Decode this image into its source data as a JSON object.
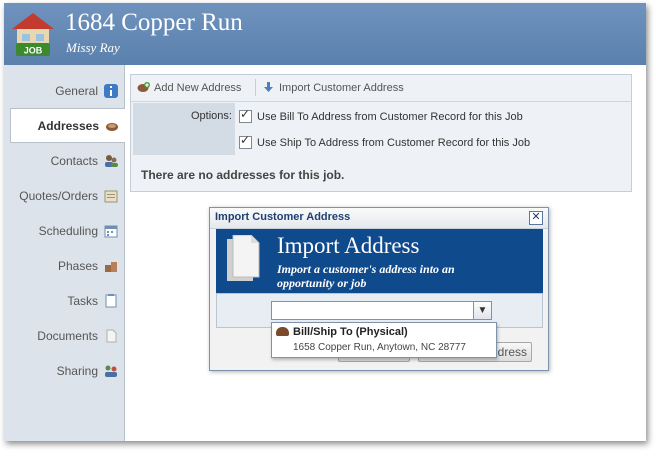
{
  "header": {
    "badge": "JOB",
    "title": "1684 Copper Run",
    "subtitle": "Missy Ray"
  },
  "sidebar": {
    "items": [
      {
        "label": "General",
        "icon": "info-icon"
      },
      {
        "label": "Addresses",
        "icon": "address-icon",
        "active": true
      },
      {
        "label": "Contacts",
        "icon": "contacts-icon"
      },
      {
        "label": "Quotes/Orders",
        "icon": "quotes-icon"
      },
      {
        "label": "Scheduling",
        "icon": "calendar-icon"
      },
      {
        "label": "Phases",
        "icon": "phases-icon"
      },
      {
        "label": "Tasks",
        "icon": "tasks-icon"
      },
      {
        "label": "Documents",
        "icon": "document-icon"
      },
      {
        "label": "Sharing",
        "icon": "sharing-icon"
      }
    ]
  },
  "toolbar": {
    "add_label": "Add New Address",
    "import_label": "Import Customer Address"
  },
  "options": {
    "label": "Options:",
    "bill_to": "Use Bill To Address from Customer Record for this Job",
    "ship_to": "Use Ship To Address from Customer Record for this Job",
    "bill_to_checked": true,
    "ship_to_checked": true
  },
  "empty_message": "There are no addresses for this job.",
  "dialog": {
    "title": "Import Customer Address",
    "close": "✕",
    "heading": "Import Address",
    "subheading": "Import a customer's address into an opportunity or job",
    "button_right_visible": "ddress",
    "combo_value": ""
  },
  "dropdown": {
    "items": [
      {
        "title": "Bill/Ship To (Physical)",
        "address": "1658 Copper Run, Anytown, NC 28777"
      }
    ]
  },
  "colors": {
    "header": "#5f84b0",
    "banner": "#0f4a8d",
    "sidebar": "#dde3ea"
  }
}
